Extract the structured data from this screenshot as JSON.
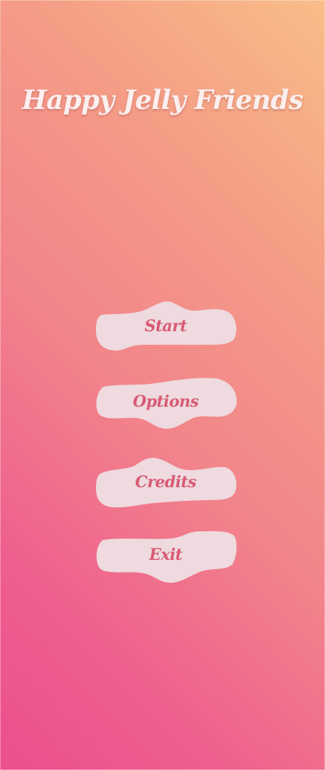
{
  "game": {
    "title": "Happy Jelly Friends"
  },
  "menu": {
    "start_label": "Start",
    "options_label": "Options",
    "credits_label": "Credits",
    "exit_label": "Exit"
  },
  "colors": {
    "background_top_right": "#f9bd88",
    "background_bottom_left": "#ec4f8e",
    "button_fill": "#eedadf",
    "button_text": "#d95a73",
    "title_text": "#fbefef"
  }
}
